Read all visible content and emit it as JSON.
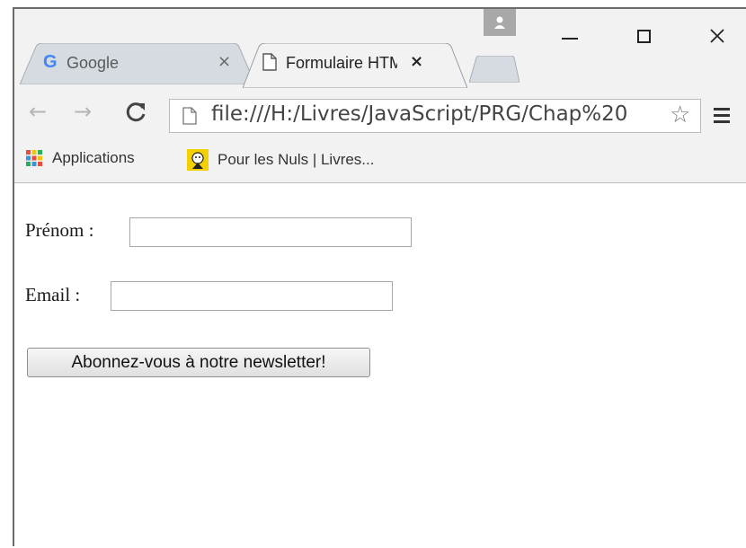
{
  "browser": {
    "tabs": [
      {
        "title": "Google",
        "icon": "google-g-icon",
        "active": false,
        "close_glyph": "×"
      },
      {
        "title": "Formulaire HTML",
        "icon": "document-icon",
        "active": true,
        "close_glyph": "×"
      }
    ],
    "window_controls": {
      "minimize": "–",
      "maximize": "☐",
      "close": "×"
    },
    "toolbar": {
      "back_glyph": "←",
      "forward_glyph": "→",
      "reload_glyph": "C",
      "address": "file:///H:/Livres/JavaScript/PRG/Chap%20",
      "star_glyph": "☆",
      "menu_glyph": "≡"
    },
    "bookmarks": [
      {
        "label": "Applications",
        "icon": "apps-grid-icon"
      },
      {
        "label": "Pour les Nuls | Livres...",
        "icon": "dummies-icon"
      }
    ]
  },
  "form": {
    "prenom_label": "Prénom :",
    "prenom_value": "",
    "email_label": "Email :",
    "email_value": "",
    "submit_label": "Abonnez-vous à notre newsletter!"
  },
  "colors": {
    "chrome_bg": "#f2f2f2",
    "inactive_tab": "#d6dbe1",
    "google_blue": "#4285f4"
  }
}
